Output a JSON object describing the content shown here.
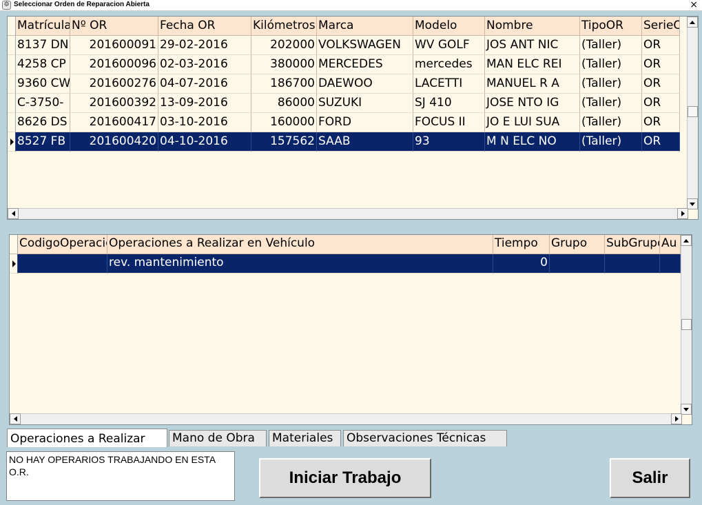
{
  "window": {
    "title": "Seleccionar Orden de Reparacion Abierta",
    "close_glyph": "×"
  },
  "orders": {
    "columns": [
      "Matrícula",
      "Nº OR",
      "Fecha OR",
      "Kilómetros",
      "Marca",
      "Modelo",
      "Nombre",
      "TipoOR",
      "SerieOR"
    ],
    "rows": [
      [
        "8137 DN",
        "201600091",
        "29-02-2016",
        "202000",
        "VOLKSWAGEN",
        "WV GOLF",
        "JOS  ANT  NIC",
        "(Taller)",
        "OR"
      ],
      [
        "4258 CP",
        "201600096",
        "02-03-2016",
        "380000",
        "MERCEDES",
        "mercedes",
        "MAN  ELC  REI",
        "(Taller)",
        "OR"
      ],
      [
        "9360 CW",
        "201600276",
        "04-07-2016",
        "186700",
        "DAEWOO",
        "LACETTI",
        "MANUEL  R  A",
        "(Taller)",
        "OR"
      ],
      [
        "C-3750-",
        "201600392",
        "13-09-2016",
        "86000",
        "SUZUKI",
        "SJ 410",
        "JOSE  NTO  IG",
        "(Taller)",
        "OR"
      ],
      [
        "8626 DS",
        "201600417",
        "03-10-2016",
        "160000",
        "FORD",
        "FOCUS II",
        "JO  E LUI  SUA",
        "(Taller)",
        "OR"
      ],
      [
        "8527 FB",
        "201600420",
        "04-10-2016",
        "157562",
        "SAAB",
        "93",
        "M  N  ELC  NO",
        "(Taller)",
        "OR"
      ]
    ],
    "selected_row": 5
  },
  "operations": {
    "columns": [
      "CodigoOperacion",
      "Operaciones a Realizar en Vehículo",
      "Tiempo",
      "Grupo",
      "SubGrupo",
      "Au"
    ],
    "rows": [
      [
        "",
        "rev. mantenimiento",
        "0",
        "",
        "",
        ""
      ]
    ],
    "selected_row": 0
  },
  "tabs": [
    {
      "label": "Operaciones a Realizar",
      "active": true
    },
    {
      "label": "Mano de Obra",
      "active": false
    },
    {
      "label": "Materiales",
      "active": false
    },
    {
      "label": "Observaciones Técnicas",
      "active": false
    }
  ],
  "status_message": "NO HAY OPERARIOS TRABAJANDO EN ESTA O.R.",
  "buttons": {
    "start": "Iniciar Trabajo",
    "exit": "Salir"
  },
  "colors": {
    "background": "#b9d2dc",
    "header": "#fde5cf",
    "grid": "#fdf8e8",
    "selection": "#0a246a"
  }
}
